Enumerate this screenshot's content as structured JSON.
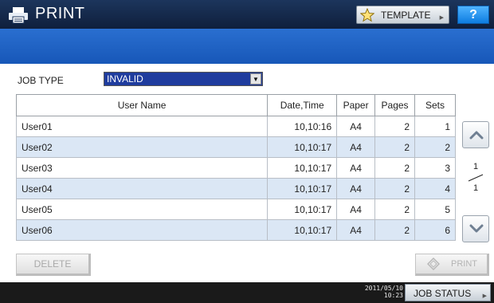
{
  "header": {
    "title": "PRINT",
    "template_label": "TEMPLATE",
    "help_label": "?"
  },
  "filter": {
    "job_type_label": "JOB TYPE",
    "job_type_value": "INVALID"
  },
  "table": {
    "columns": [
      "User Name",
      "Date,Time",
      "Paper",
      "Pages",
      "Sets"
    ],
    "rows": [
      {
        "user": "User01",
        "datetime": "10,10:16",
        "paper": "A4",
        "pages": "2",
        "sets": "1"
      },
      {
        "user": "User02",
        "datetime": "10,10:17",
        "paper": "A4",
        "pages": "2",
        "sets": "2"
      },
      {
        "user": "User03",
        "datetime": "10,10:17",
        "paper": "A4",
        "pages": "2",
        "sets": "3"
      },
      {
        "user": "User04",
        "datetime": "10,10:17",
        "paper": "A4",
        "pages": "2",
        "sets": "4"
      },
      {
        "user": "User05",
        "datetime": "10,10:17",
        "paper": "A4",
        "pages": "2",
        "sets": "5"
      },
      {
        "user": "User06",
        "datetime": "10,10:17",
        "paper": "A4",
        "pages": "2",
        "sets": "6"
      }
    ]
  },
  "pagination": {
    "current": "1",
    "total": "1"
  },
  "actions": {
    "delete_label": "DELETE",
    "print_label": "PRINT"
  },
  "status": {
    "date": "2011/05/10",
    "time": "10:23",
    "job_status_label": "JOB STATUS"
  },
  "icons": {
    "print": "printer-icon",
    "template": "star-icon",
    "scroll_up": "chevron-up-icon",
    "scroll_down": "chevron-down-icon",
    "print_button": "diamond-icon"
  },
  "colors": {
    "titlebar": "#1c355c",
    "band": "#2a6fd0",
    "select_bg": "#1f3c9e",
    "alt_row": "#dbe7f5",
    "help_button": "#0d7ce0",
    "statusbar": "#1a1a1a"
  }
}
